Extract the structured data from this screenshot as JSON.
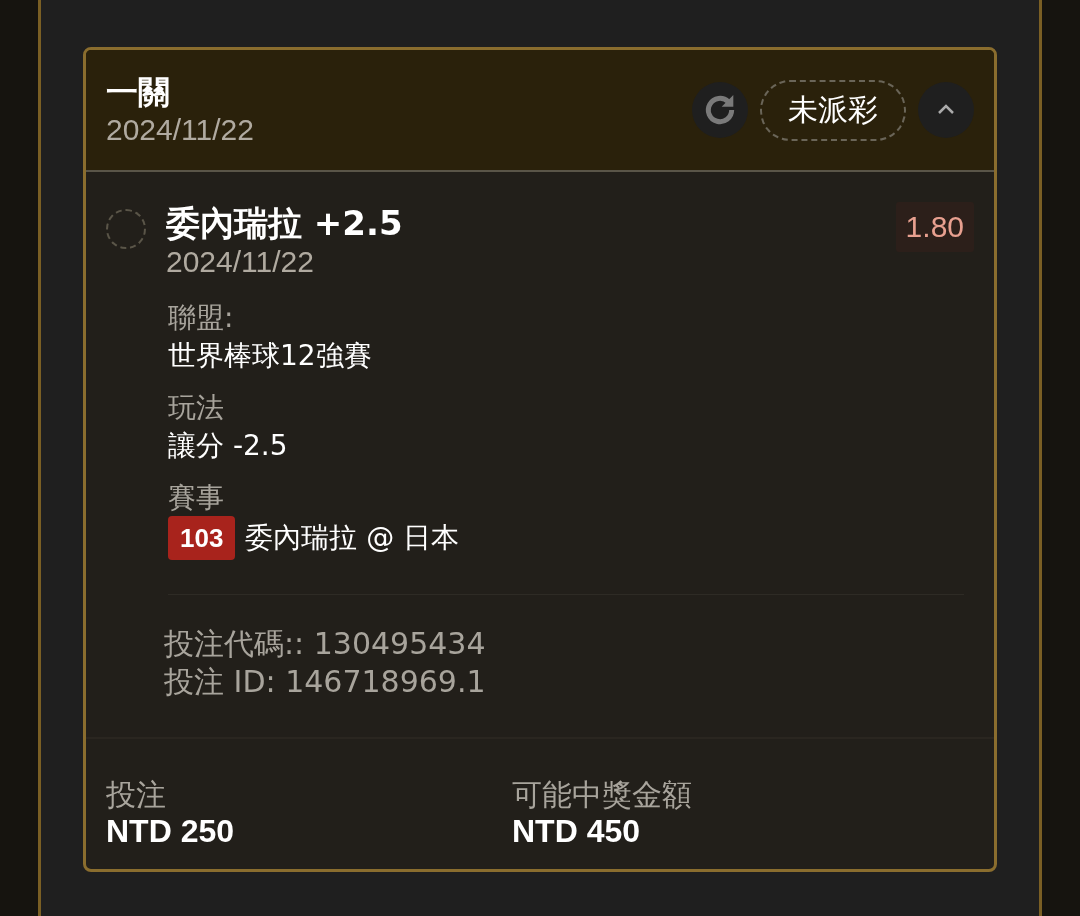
{
  "card": {
    "title": "一關",
    "date": "2024/11/22",
    "status": "未派彩",
    "expanded": true
  },
  "selection": {
    "name": "委內瑞拉 +2.5",
    "date": "2024/11/22",
    "odds": "1.80",
    "details": [
      {
        "label": "聯盟:",
        "value": "世界棒球12強賽"
      },
      {
        "label": "玩法",
        "value": "讓分 -2.5"
      },
      {
        "label": "賽事",
        "badge": "103",
        "value": "委內瑞拉 @ 日本"
      }
    ],
    "codes": [
      "投注代碼:: 130495434",
      "投注 ID: 146718969.1"
    ]
  },
  "summary": [
    {
      "label": "投注",
      "value": "NTD 250"
    },
    {
      "label": "可能中獎金額",
      "value": "NTD 450"
    }
  ]
}
